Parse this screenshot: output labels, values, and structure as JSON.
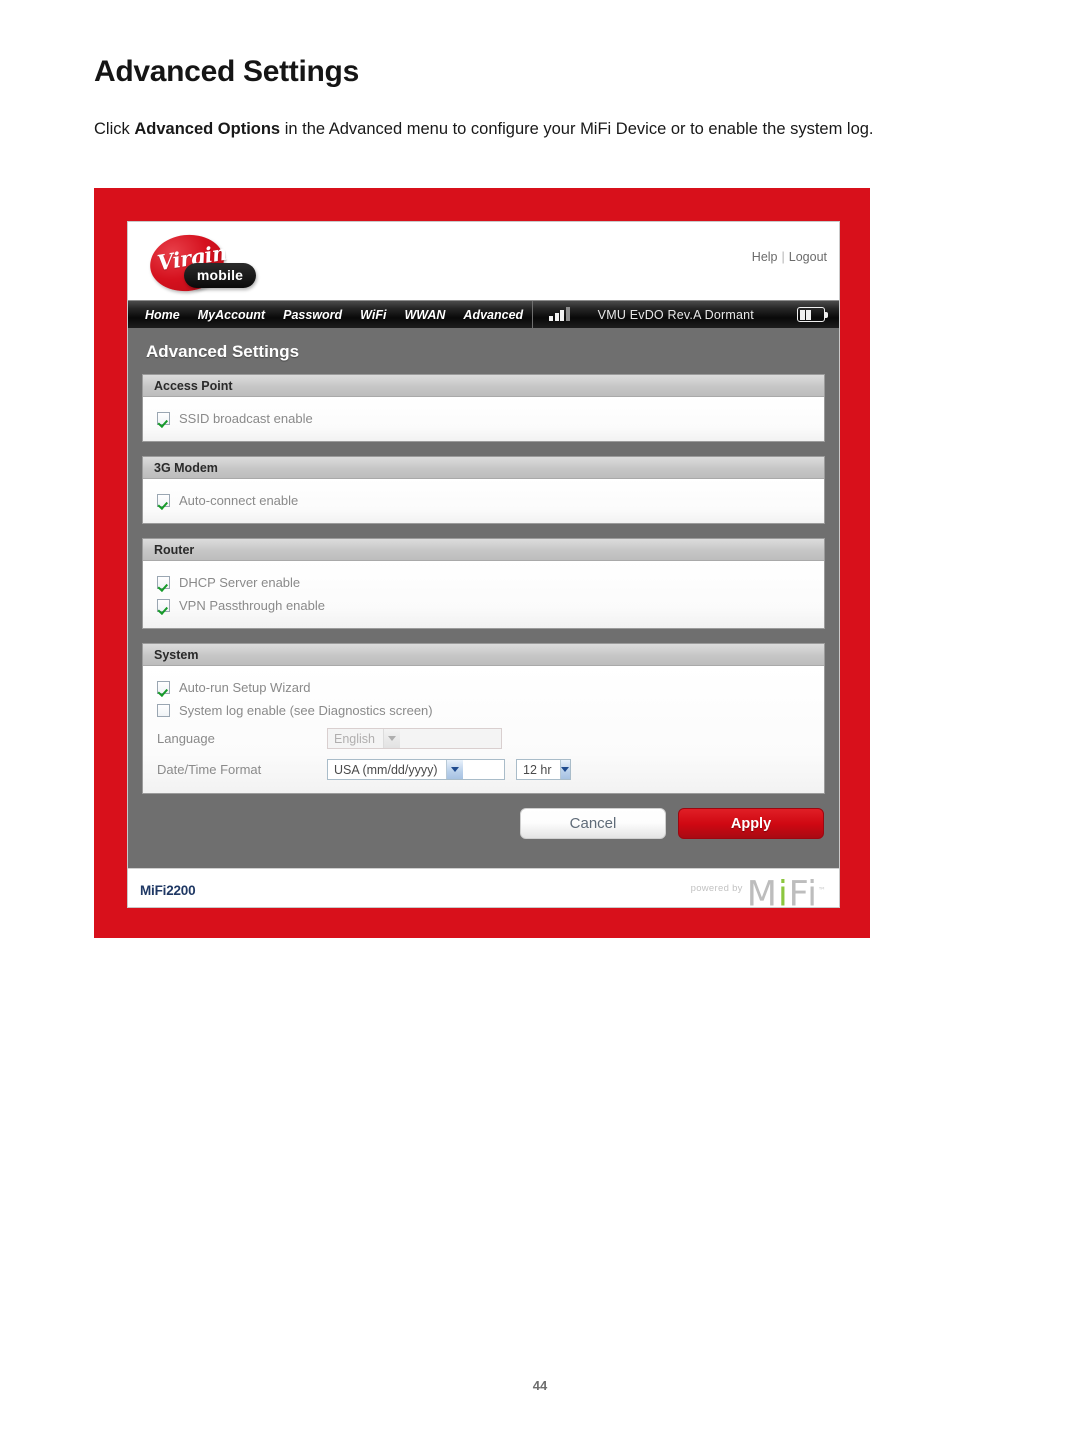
{
  "document": {
    "heading": "Advanced Settings",
    "paragraph_pre": "Click ",
    "paragraph_bold": "Advanced Options",
    "paragraph_post": " in the Advanced menu to configure your MiFi Device or to enable the system log.",
    "page_number": "44"
  },
  "colors": {
    "frame_red": "#d8101b",
    "apply_red": "#cf0812",
    "body_gray": "#6f6f6f",
    "check_green": "#169b29",
    "footer_navy": "#1f3864",
    "mifi_green": "#8cc63f"
  },
  "screenshot": {
    "brand": {
      "logo_script": "Virgin",
      "logo_pill": "mobile"
    },
    "header_links": {
      "help": "Help",
      "separator": "|",
      "logout": "Logout"
    },
    "nav": {
      "items": [
        {
          "label": "Home"
        },
        {
          "label": "MyAccount"
        },
        {
          "label": "Password"
        },
        {
          "label": "WiFi"
        },
        {
          "label": "WWAN"
        },
        {
          "label": "Advanced"
        }
      ]
    },
    "status": {
      "signal_bars_total": 4,
      "signal_bars_filled": 3,
      "text": "VMU  EvDO Rev.A  Dormant",
      "battery_segments": 2
    },
    "panel_title": "Advanced Settings",
    "sections": [
      {
        "title": "Access Point",
        "checkboxes": [
          {
            "label": "SSID broadcast enable",
            "checked": true
          }
        ]
      },
      {
        "title": "3G Modem",
        "checkboxes": [
          {
            "label": "Auto-connect enable",
            "checked": true
          }
        ]
      },
      {
        "title": "Router",
        "checkboxes": [
          {
            "label": "DHCP Server enable",
            "checked": true
          },
          {
            "label": "VPN Passthrough enable",
            "checked": true
          }
        ]
      },
      {
        "title": "System",
        "checkboxes": [
          {
            "label": "Auto-run Setup Wizard",
            "checked": true
          },
          {
            "label": "System log enable (see Diagnostics screen)",
            "checked": false
          }
        ],
        "fields": [
          {
            "label": "Language",
            "value": "English",
            "disabled": true
          },
          {
            "label": "Date/Time Format",
            "value": "USA (mm/dd/yyyy)",
            "value2": "12 hr",
            "disabled": false
          }
        ]
      }
    ],
    "buttons": {
      "cancel": "Cancel",
      "apply": "Apply"
    },
    "footer": {
      "model": "MiFi2200",
      "powered_by": "powered by",
      "wordmark_m": "M",
      "wordmark_i": "i",
      "wordmark_f": "F",
      "wordmark_i2": "i",
      "trademark": "™"
    }
  }
}
